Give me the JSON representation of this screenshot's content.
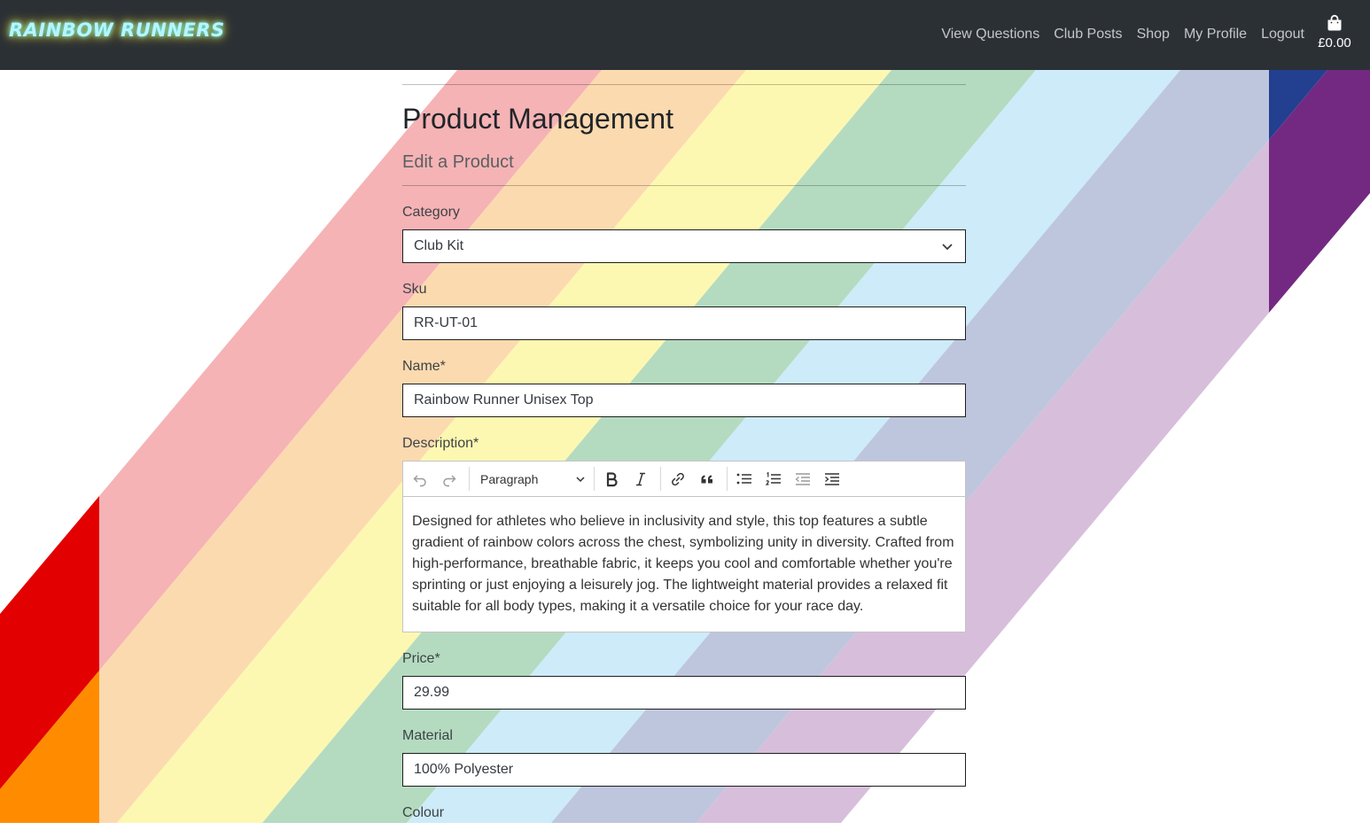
{
  "brand": {
    "logo_text": "RAINBOW RUNNERS"
  },
  "nav": {
    "links": [
      "View Questions",
      "Club Posts",
      "Shop",
      "My Profile",
      "Logout"
    ],
    "bag_icon": "shopping-bag-icon",
    "bag_total": "£0.00"
  },
  "page": {
    "title": "Product Management",
    "subtitle": "Edit a Product"
  },
  "form": {
    "category": {
      "label": "Category",
      "value": "Club Kit"
    },
    "sku": {
      "label": "Sku",
      "value": "RR-UT-01"
    },
    "name": {
      "label": "Name*",
      "value": "Rainbow Runner Unisex Top"
    },
    "description": {
      "label": "Description*",
      "toolbar": {
        "heading_select": "Paragraph",
        "icons": [
          "undo-icon",
          "redo-icon",
          "bold-icon",
          "italic-icon",
          "link-icon",
          "blockquote-icon",
          "bulleted-list-icon",
          "numbered-list-icon",
          "outdent-icon",
          "indent-icon"
        ]
      },
      "value": "Designed for athletes who believe in inclusivity and style, this top features a subtle gradient of rainbow colors across the chest, symbolizing unity in diversity. Crafted from high-performance, breathable fabric, it keeps you cool and comfortable whether you're sprinting or just enjoying a leisurely jog. The lightweight material provides a relaxed fit suitable for all body types, making it a versatile choice for your race day."
    },
    "price": {
      "label": "Price*",
      "value": "29.99"
    },
    "material": {
      "label": "Material",
      "value": "100% Polyester"
    },
    "colour": {
      "label": "Colour"
    }
  },
  "colors": {
    "navbar": "#2b3035",
    "stripes_pale": [
      "#f5b3b5",
      "#fcdaaf",
      "#fdf8b1",
      "#b4dbc0",
      "#cdebf9",
      "#bec6de",
      "#d7bedb"
    ],
    "stripes_bold": [
      "#e30000",
      "#ff8c00",
      "#233f8f",
      "#732982"
    ]
  }
}
